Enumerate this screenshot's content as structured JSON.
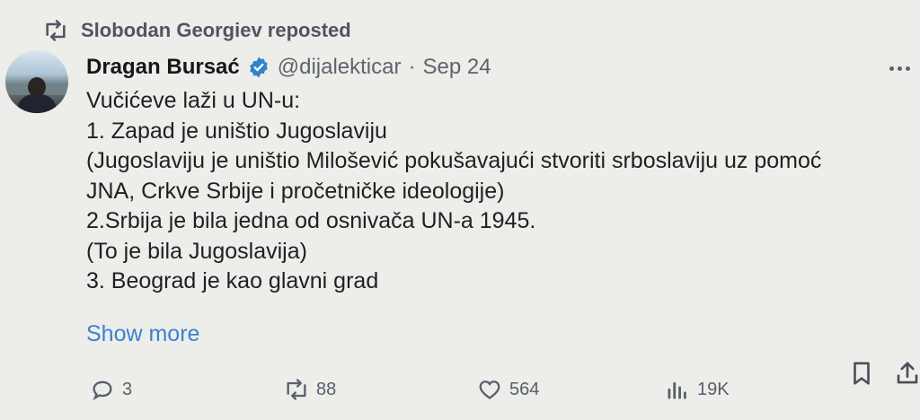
{
  "repost": {
    "icon": "repost-icon",
    "text": "Slobodan Georgiev reposted"
  },
  "tweet": {
    "author_name": "Dragan Bursać",
    "verified_icon": "verified-badge-icon",
    "handle": "@dijalekticar",
    "separator": "·",
    "date": "Sep 24",
    "lines": [
      "Vučićeve laži u UN-u:",
      "1. Zapad je uništio Jugoslaviju",
      "(Jugoslaviju je uništio Milošević pokušavajući stvoriti srboslaviju uz pomoć",
      "JNA, Crkve Srbije i pročetničke ideologije)",
      "2.Srbija je bila jedna od osnivača UN-a 1945.",
      "(To je bila Jugoslavija)",
      "3. Beograd je kao glavni grad"
    ],
    "show_more": "Show more"
  },
  "actions": {
    "replies": "3",
    "reposts": "88",
    "likes": "564",
    "views": "19K"
  },
  "colors": {
    "background": "#ededea",
    "link": "#3b82cf",
    "verified": "#2f83c9",
    "muted": "#5d646c"
  }
}
